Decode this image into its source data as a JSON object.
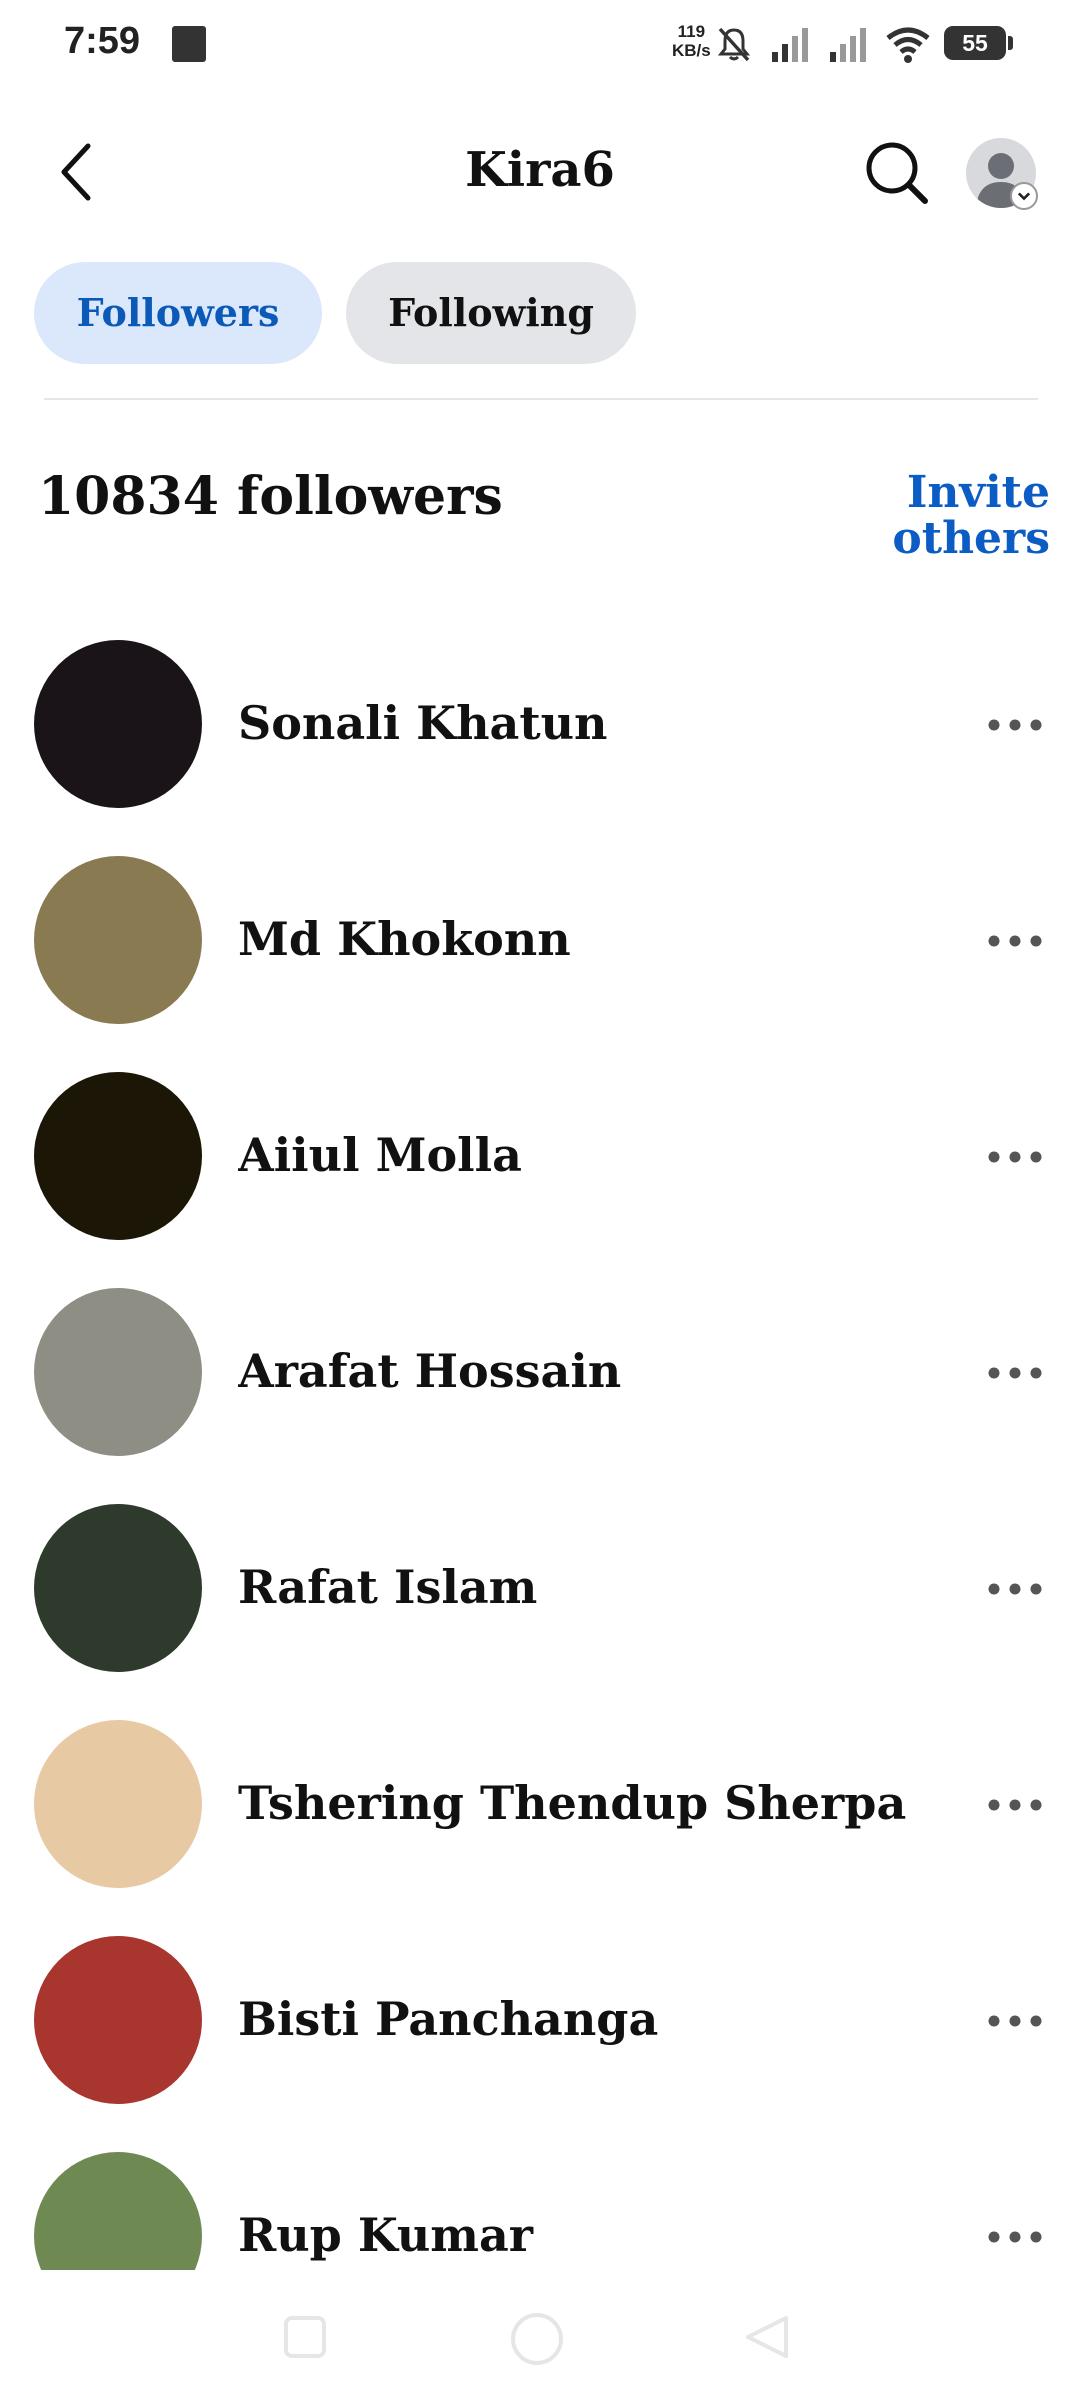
{
  "status": {
    "time": "7:59",
    "net_speed": "119",
    "net_unit": "KB/s",
    "battery": "55",
    "icons": [
      "notification-icon",
      "mute-icon",
      "signal-icon",
      "signal-icon",
      "wifi-icon",
      "battery-icon"
    ]
  },
  "header": {
    "title": "Kira6"
  },
  "tabs": [
    {
      "label": "Followers",
      "active": true
    },
    {
      "label": "Following",
      "active": false
    }
  ],
  "followers": {
    "count_label": "10834 followers",
    "invite_line1": "Invite",
    "invite_line2": "others"
  },
  "list": [
    {
      "name": "Sonali Khatun",
      "avatar_color": "#1a1418"
    },
    {
      "name": "Md Khokonn",
      "avatar_color": "#8a7a52"
    },
    {
      "name": "Aiiul Molla",
      "avatar_color": "#1b1606"
    },
    {
      "name": "Arafat Hossain",
      "avatar_color": "#8f8e84"
    },
    {
      "name": "Rafat Islam",
      "avatar_color": "#2e3a2c"
    },
    {
      "name": "Tshering Thendup Sherpa",
      "avatar_color": "#e7c9a3"
    },
    {
      "name": "Bisti Panchanga",
      "avatar_color": "#a8362f"
    },
    {
      "name": "Rup Kumar",
      "avatar_color": "#6e8a52"
    }
  ],
  "navbar": {
    "icons": [
      "recent-apps-icon",
      "home-icon",
      "back-nav-icon"
    ]
  }
}
